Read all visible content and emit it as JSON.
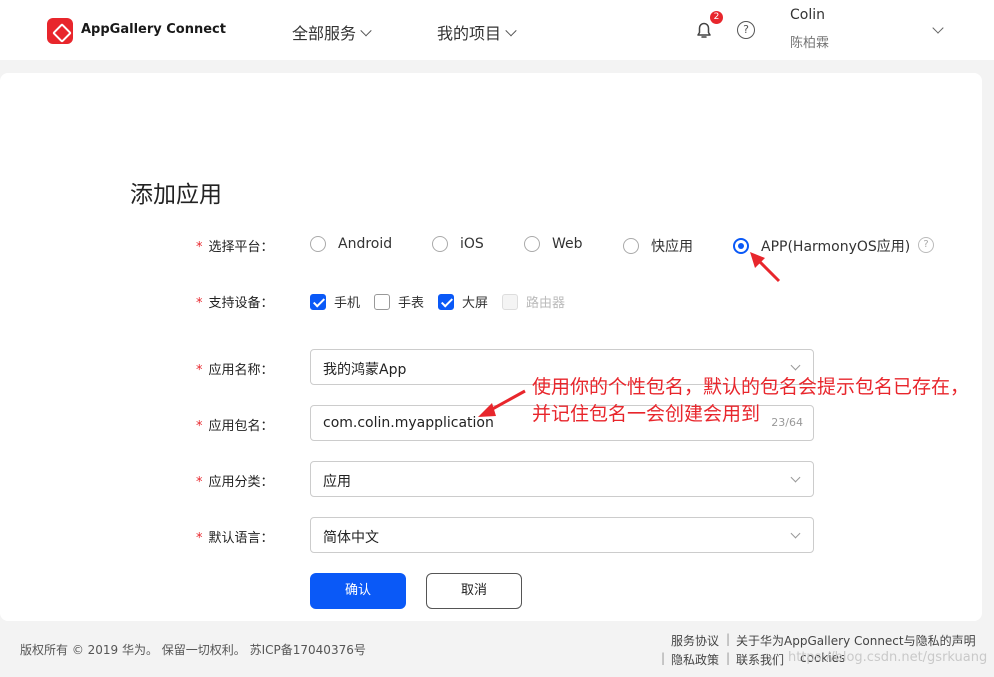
{
  "header": {
    "brand": "AppGallery Connect",
    "nav": [
      {
        "label": "全部服务"
      },
      {
        "label": "我的项目"
      }
    ],
    "notification_count": "2",
    "help_glyph": "?",
    "user": {
      "name": "Colin",
      "subtitle": "陈柏霖"
    }
  },
  "page": {
    "title": "添加应用",
    "required_mark": "*",
    "platform": {
      "label": "选择平台：",
      "options": [
        "Android",
        "iOS",
        "Web",
        "快应用",
        "APP(HarmonyOS应用)"
      ],
      "selected": "APP(HarmonyOS应用)"
    },
    "devices": {
      "label": "支持设备：",
      "options": [
        {
          "label": "手机",
          "checked": true,
          "disabled": false
        },
        {
          "label": "手表",
          "checked": false,
          "disabled": false
        },
        {
          "label": "大屏",
          "checked": true,
          "disabled": false
        },
        {
          "label": "路由器",
          "checked": false,
          "disabled": true
        }
      ]
    },
    "app_name": {
      "label": "应用名称：",
      "value": "我的鸿蒙App"
    },
    "package_name": {
      "label": "应用包名：",
      "value": "com.colin.myapplication",
      "counter": "23/64"
    },
    "category": {
      "label": "应用分类：",
      "value": "应用"
    },
    "language": {
      "label": "默认语言：",
      "value": "简体中文"
    },
    "confirm_label": "确认",
    "cancel_label": "取消"
  },
  "annotation": {
    "text": "使用你的个性包名，默认的包名会提示包名已存在，并记住包名一会创建会用到"
  },
  "footer": {
    "copyright": "版权所有 © 2019 华为。 保留一切权利。 苏ICP备17040376号",
    "links": [
      "服务协议",
      "关于华为AppGallery Connect与隐私的声明",
      "隐私政策",
      "联系我们",
      "cookies"
    ],
    "watermark": "https://blog.csdn.net/gsrkuang"
  },
  "colors": {
    "accent": "#0a59f7",
    "brand_red": "#e8262c"
  }
}
